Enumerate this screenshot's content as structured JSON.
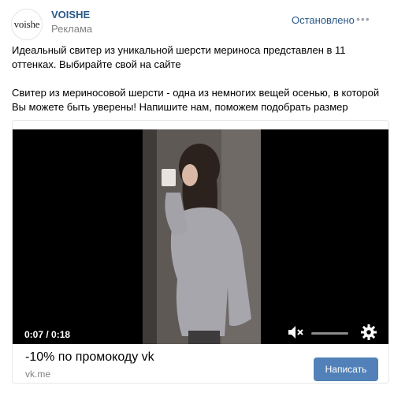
{
  "post": {
    "author": "VOISHE",
    "avatar_text": "voishe",
    "subtitle": "Реклама",
    "status": "Остановлено",
    "more": "•••",
    "text_1": "Идеальный свитер из уникальной шерсти мериноса представлен в 11 оттенках. Выбирайте свой на сайте",
    "text_2": "Свитер из мериносовой шерсти - одна из немногих вещей осенью, в которой Вы можете быть уверены! Напишите нам, поможем подобрать размер"
  },
  "video": {
    "time": "0:07 / 0:18",
    "volume": 0
  },
  "ad": {
    "title": "-10% по промокоду vk",
    "domain": "vk.me",
    "cta": "Написать"
  },
  "colors": {
    "link": "#2a5885",
    "button": "#5181b8",
    "muted": "#828282"
  }
}
